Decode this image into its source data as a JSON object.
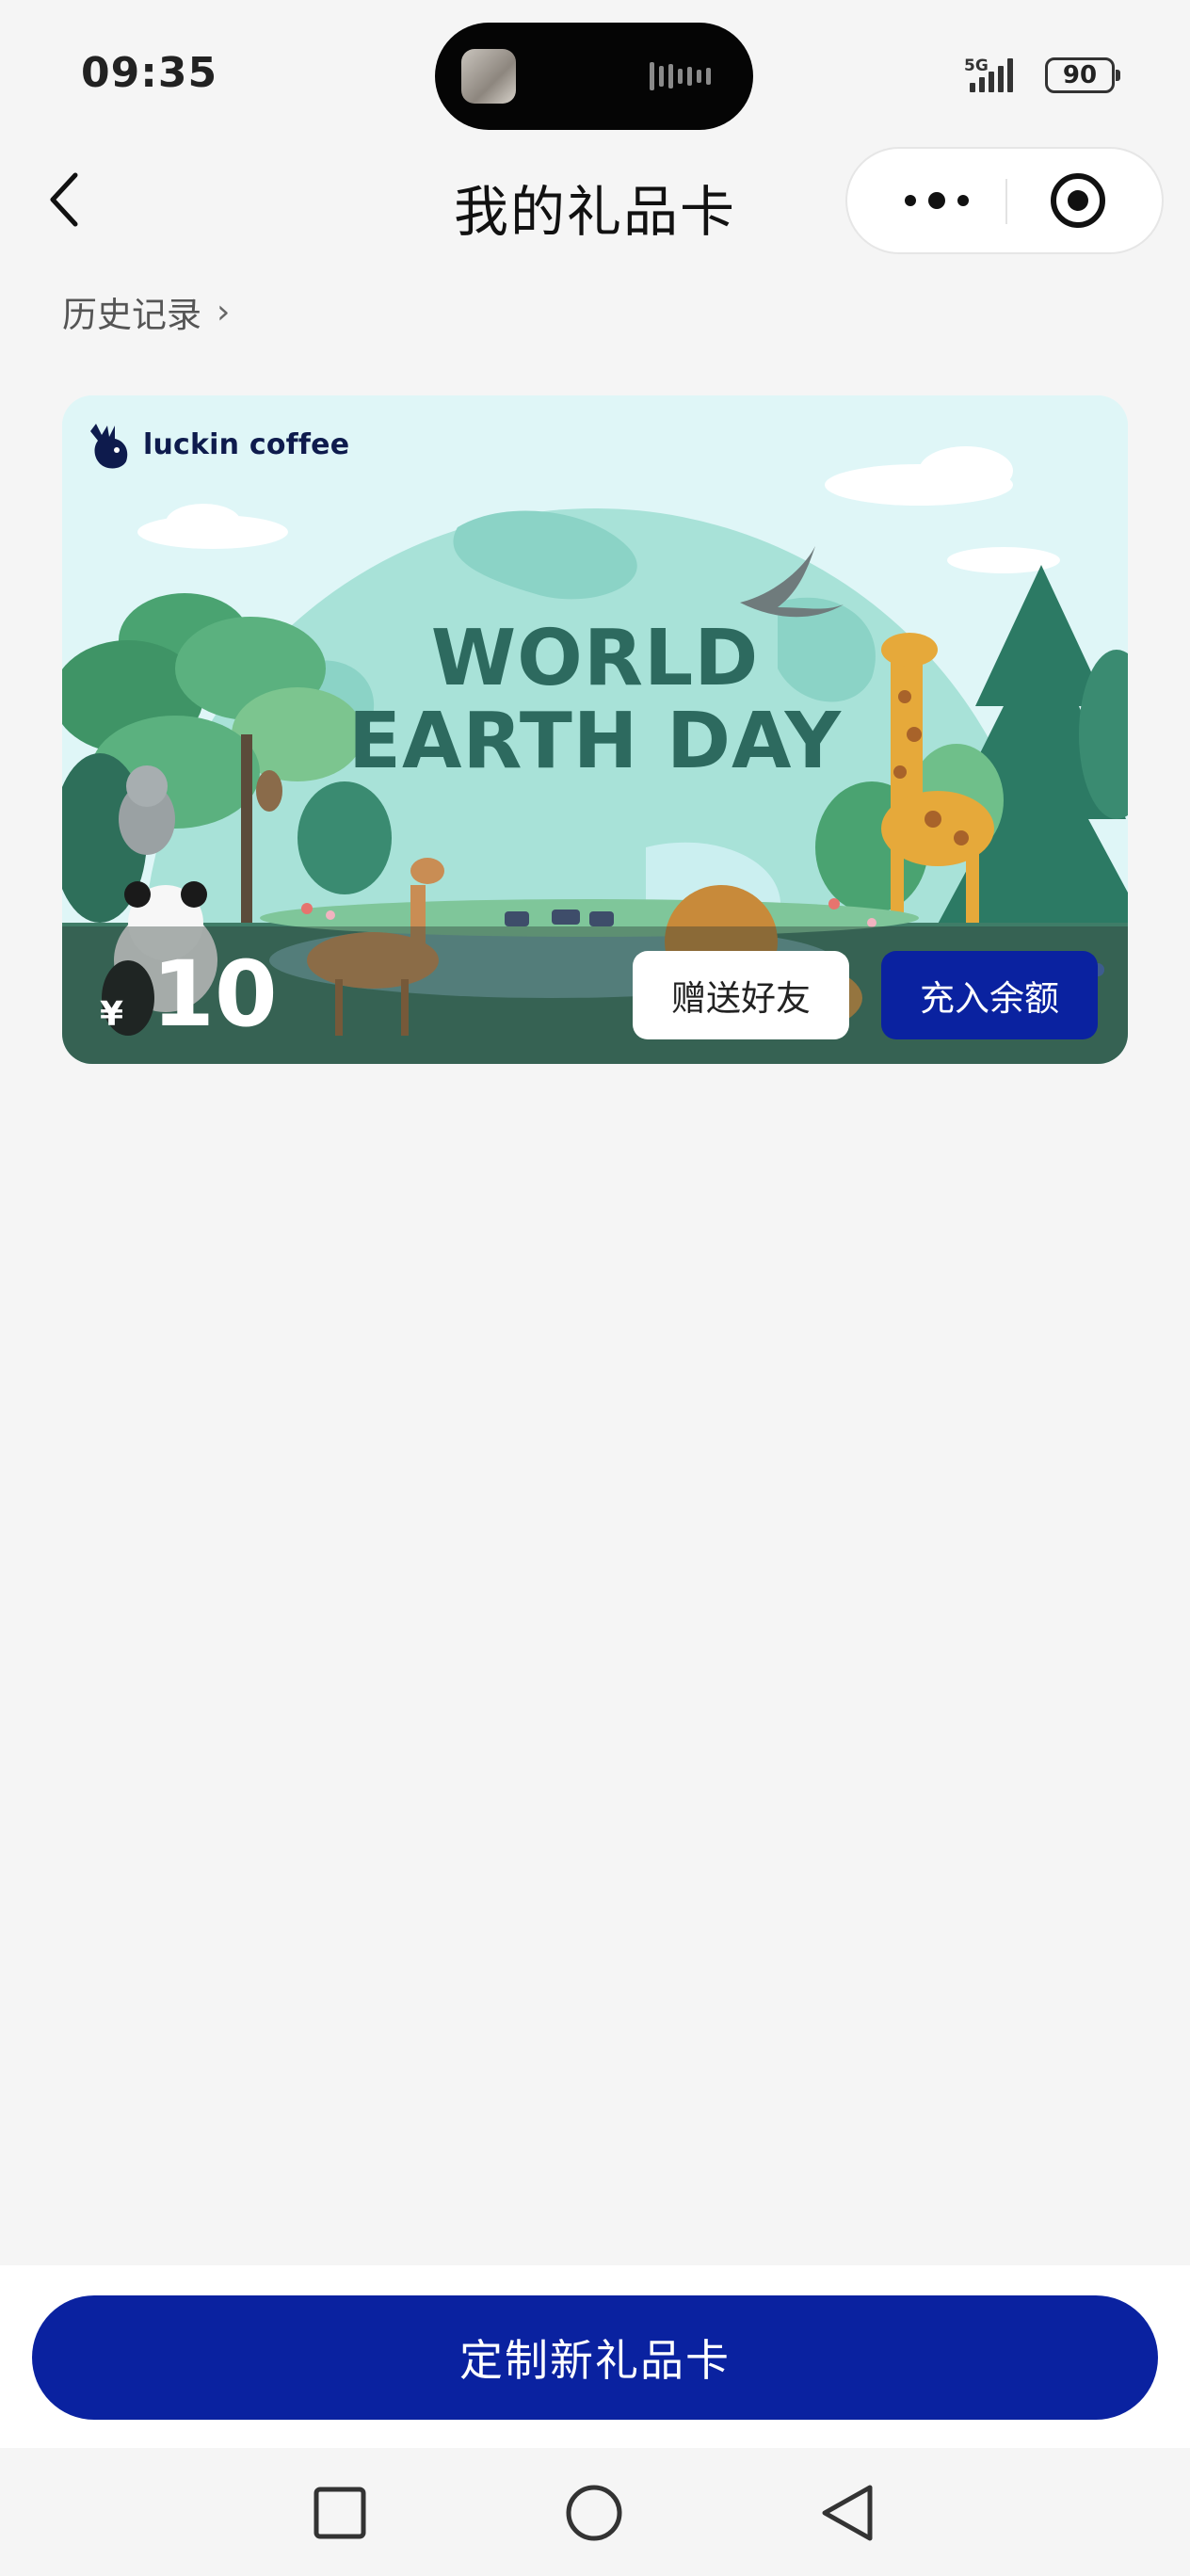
{
  "status_bar": {
    "time": "09:35",
    "network": "5G",
    "battery": "90"
  },
  "nav": {
    "title": "我的礼品卡"
  },
  "history": {
    "label": "历史记录",
    "chevron": "›"
  },
  "card": {
    "brand": "luckin coffee",
    "headline_line1": "WORLD",
    "headline_line2": "EARTH DAY",
    "currency": "¥",
    "amount": "10",
    "gift_button": "赠送好友",
    "recharge_button": "充入余额"
  },
  "footer": {
    "custom_button": "定制新礼品卡"
  },
  "colors": {
    "primary": "#0a22a0",
    "background": "#f5f5f5",
    "card_sky": "#dff6f7",
    "headline": "#2d6a5f"
  },
  "icons": {
    "back": "chevron-left-icon",
    "more": "more-dots-icon",
    "close_miniprogram": "target-circle-icon",
    "recent_apps": "square-icon",
    "home": "circle-icon",
    "back_system": "triangle-back-icon"
  }
}
